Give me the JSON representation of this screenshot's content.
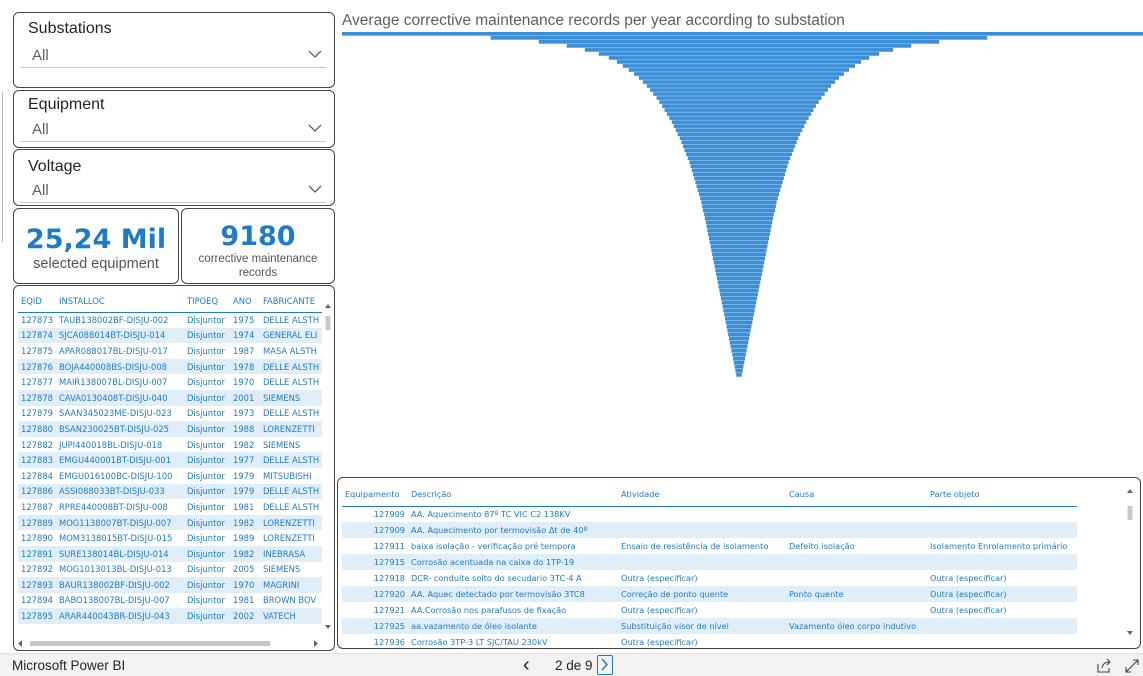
{
  "slicers": [
    {
      "title": "Substations",
      "value": "All"
    },
    {
      "title": "Equipment",
      "value": "All"
    },
    {
      "title": "Voltage",
      "value": "All"
    }
  ],
  "cards": [
    {
      "value": "25,24 Mil",
      "label": "selected equipment"
    },
    {
      "value": "9180",
      "label": "corrective maintenance records"
    }
  ],
  "equipment_table": {
    "columns": [
      "EQID",
      "INSTALLOC",
      "TIPOEQ",
      "ANO",
      "FABRICANTE"
    ],
    "rows": [
      [
        "127873",
        "TAUB138002BF-DISJU-002",
        "Disjuntor",
        "1975",
        "DELLE ALSTH"
      ],
      [
        "127874",
        "SJCA088014BT-DISJU-014",
        "Disjuntor",
        "1974",
        "GENERAL ELI"
      ],
      [
        "127875",
        "APAR088017BL-DISJU-017",
        "Disjuntor",
        "1987",
        "MASA ALSTH"
      ],
      [
        "127876",
        "BOJA440008BS-DISJU-008",
        "Disjuntor",
        "1978",
        "DELLE ALSTH"
      ],
      [
        "127877",
        "MAIR138007BL-DISJU-007",
        "Disjuntor",
        "1970",
        "DELLE ALSTH"
      ],
      [
        "127878",
        "CAVA0130408T-DISJU-040",
        "Disjuntor",
        "2001",
        "SIEMENS"
      ],
      [
        "127879",
        "SAAN345023ME-DISJU-023",
        "Disjuntor",
        "1973",
        "DELLE ALSTH"
      ],
      [
        "127880",
        "BSAN230025BT-DISJU-025",
        "Disjuntor",
        "1988",
        "LORENZETTI"
      ],
      [
        "127882",
        "JUPI440018BL-DISJU-018",
        "Disjuntor",
        "1982",
        "SIEMENS"
      ],
      [
        "127883",
        "EMGU440001BT-DISJU-001",
        "Disjuntor",
        "1977",
        "DELLE ALSTH"
      ],
      [
        "127884",
        "EMGU016100BC-DISJU-100",
        "Disjuntor",
        "1979",
        "MITSUBISHI"
      ],
      [
        "127886",
        "ASSI088033BT-DISJU-033",
        "Disjuntor",
        "1979",
        "DELLE ALSTH"
      ],
      [
        "127887",
        "RPRE440008BT-DISJU-008",
        "Disjuntor",
        "1981",
        "DELLE ALSTH"
      ],
      [
        "127889",
        "MOG1138007BT-DISJU-007",
        "Disjuntor",
        "1982",
        "LORENZETTI"
      ],
      [
        "127890",
        "MOM3138015BT-DISJU-015",
        "Disjuntor",
        "1989",
        "LORENZETTI"
      ],
      [
        "127891",
        "SURE138014BL-DISJU-014",
        "Disjuntor",
        "1982",
        "INEBRASA"
      ],
      [
        "127892",
        "MOG1013013BL-DISJU-013",
        "Disjuntor",
        "2005",
        "SIEMENS"
      ],
      [
        "127893",
        "BAUR138002BF-DISJU-002",
        "Disjuntor",
        "1970",
        "MAGRINI"
      ],
      [
        "127894",
        "BABO138007BL-DISJU-007",
        "Disjuntor",
        "1981",
        "BROWN BOV"
      ],
      [
        "127895",
        "ARAR440043BR-DISJU-043",
        "Disjuntor",
        "2002",
        "VATECH"
      ]
    ]
  },
  "chart_data": {
    "type": "bar",
    "orientation": "horizontal",
    "title": "Average corrective maintenance records per year according to substation",
    "xlabel": "",
    "ylabel": "",
    "grid": false,
    "color": "#3a8fd6",
    "note_values_relative": true,
    "values": [
      1.0,
      0.62,
      0.5,
      0.43,
      0.385,
      0.35,
      0.325,
      0.305,
      0.29,
      0.275,
      0.262,
      0.25,
      0.24,
      0.23,
      0.222,
      0.214,
      0.206,
      0.199,
      0.192,
      0.186,
      0.18,
      0.174,
      0.168,
      0.163,
      0.158,
      0.153,
      0.148,
      0.144,
      0.14,
      0.136,
      0.132,
      0.128,
      0.124,
      0.121,
      0.118,
      0.115,
      0.112,
      0.109,
      0.106,
      0.103,
      0.1,
      0.097,
      0.094,
      0.092,
      0.09,
      0.087,
      0.085,
      0.083,
      0.081,
      0.079,
      0.077,
      0.075,
      0.073,
      0.071,
      0.069,
      0.067,
      0.065,
      0.063,
      0.061,
      0.059,
      0.057,
      0.055,
      0.053,
      0.051,
      0.049,
      0.047,
      0.045,
      0.043,
      0.041,
      0.039,
      0.037,
      0.035,
      0.033,
      0.031,
      0.029,
      0.027,
      0.025,
      0.023,
      0.021,
      0.019,
      0.017,
      0.015,
      0.013,
      0.011,
      0.009,
      0.007
    ]
  },
  "records_table": {
    "columns": [
      "Equipamento",
      "Descrição",
      "Atividade",
      "Causa",
      "Parte objeto"
    ],
    "rows": [
      [
        "127909",
        "AA. Aquecimento 87º TC VIC C2 138KV",
        "",
        "",
        ""
      ],
      [
        "127909",
        "AA. Aquecimento por termovisão Δt de 40º",
        "",
        "",
        ""
      ],
      [
        "127911",
        "baixa isolação - verificação pré tempora",
        "Ensaio de resistência de isolamento",
        "Defeito isolação",
        "Isolamento Enrolamento primário"
      ],
      [
        "127915",
        "Corrosão acentuada na caixa do 1TP-19",
        "",
        "",
        ""
      ],
      [
        "127918",
        "DCR- condulte solto do secudario 3TC-4 A",
        "Outra (especificar)",
        "",
        "Outra (especificar)"
      ],
      [
        "127920",
        "AA. Aquec detectado por termovisão 3TC8",
        "Correção de ponto quente",
        "Ponto quente",
        "Outra (especificar)"
      ],
      [
        "127921",
        "AA.Corrosão nos parafusos de fixação",
        "Outra (especificar)",
        "",
        "Outra (especificar)"
      ],
      [
        "127925",
        "aa.vazamento de óleo isolante",
        "Substituição visor de nível",
        "Vazamento óleo corpo indutivo",
        ""
      ],
      [
        "127936",
        "Corrosão 3TP-3 LT SJC/TAU 230kV",
        "Outra (especificar)",
        "",
        ""
      ]
    ]
  },
  "footer": {
    "brand": "Microsoft Power BI",
    "page": "2 de 9"
  },
  "icons": {
    "dropdown": "chevron-down-icon",
    "prev": "chevron-left-icon",
    "next": "chevron-right-icon",
    "share": "share-icon",
    "fullscreen": "fullscreen-icon"
  }
}
